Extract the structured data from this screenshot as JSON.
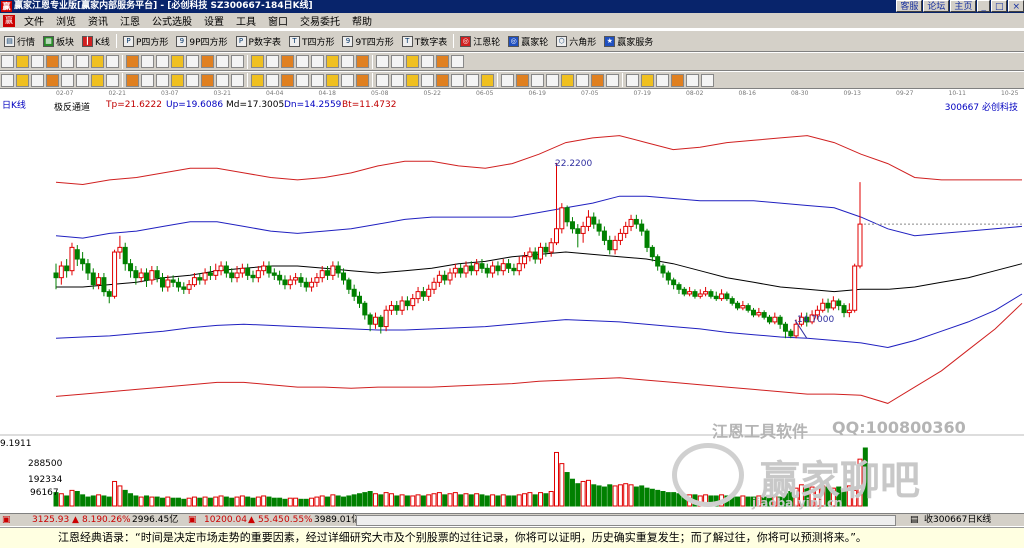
{
  "window": {
    "title": "赢家江恩专业版[赢家内部服务平台] - [必创科技  SZ300667-184日K线]",
    "buttons": [
      "客服",
      "论坛",
      "主页"
    ]
  },
  "menu": [
    "文件",
    "浏览",
    "资讯",
    "江恩",
    "公式选股",
    "设置",
    "工具",
    "窗口",
    "交易委托",
    "帮助"
  ],
  "toolbar1": [
    "行情",
    "板块",
    "K线",
    "P四方形",
    "9P四方形",
    "P数字表",
    "T四方形",
    "9T四方形",
    "T数字表",
    "江恩轮",
    "赢家轮",
    "六角形",
    "赢家服务"
  ],
  "toolbar2_icon_count": 30,
  "toolbar3_icon_count": 46,
  "date_ticks": [
    "02-07",
    "02-21",
    "03-07",
    "03-21",
    "04-04",
    "04-18",
    "05-08",
    "05-22",
    "06-05",
    "06-19",
    "07-05",
    "07-19",
    "08-02",
    "08-16",
    "08-30",
    "09-13",
    "09-27",
    "10-11",
    "10-25"
  ],
  "chart_header": {
    "period": "日K线",
    "indicator": "极反通道",
    "tp": "Tp=21.6222",
    "up": "Up=19.6086",
    "md": "Md=17.3005",
    "dn": "Dn=14.2559",
    "bt": "Bt=11.4732",
    "stock": "300667  必创科技"
  },
  "chart_annotations": {
    "high": "22.2200",
    "low": "14.7000"
  },
  "volume_axis": [
    "9.1911",
    "288500",
    "192334",
    "96167"
  ],
  "watermark": {
    "brand": "江恩工具软件",
    "qq": "QQ:100800360",
    "cn": "赢家聊吧",
    "url": "jiaoba.yinj.cn"
  },
  "status_bar": {
    "sh": "3125.93",
    "sh_chg": "8.19",
    "sh_pct": "0.26%",
    "sh_amt": "2996.45亿",
    "sz": "10200.04",
    "sz_chg": "55.45",
    "sz_pct": "0.55%",
    "sz_amt": "3989.01亿",
    "right": "收300667日K线"
  },
  "quote": "江恩经典语录：“时间是决定市场走势的重要因素，经过详细研究大市及个别股票的过往记录，你将可以证明，历史确实重复发生；而了解过往，你将可以预测将来。”。",
  "chart_data": {
    "type": "candlestick",
    "title": "极反通道",
    "ylim": [
      10.5,
      24.5
    ],
    "annotations": {
      "high": 22.22,
      "low": 14.7
    },
    "bands": {
      "tp": [
        21.4,
        21.3,
        21.5,
        21.6,
        21.8,
        22.0,
        22.0,
        21.8,
        21.6,
        21.5,
        21.6,
        21.8,
        22.1,
        22.3,
        22.3,
        22.1,
        22.0,
        22.2,
        22.6,
        23.1,
        23.3,
        23.4,
        23.1,
        22.8,
        22.9,
        23.1,
        23.2,
        23.3,
        23.4,
        23.1,
        22.6,
        22.2,
        21.6,
        21.5,
        21.5,
        21.5,
        21.5
      ],
      "up": [
        19.1,
        19.0,
        19.2,
        19.3,
        19.5,
        19.7,
        19.7,
        19.5,
        19.3,
        19.2,
        19.3,
        19.4,
        19.6,
        19.8,
        19.9,
        19.9,
        19.9,
        19.9,
        20.1,
        20.3,
        20.5,
        20.8,
        20.8,
        20.7,
        20.6,
        20.6,
        20.6,
        20.5,
        20.4,
        20.3,
        19.9,
        19.4,
        19.1,
        19.2,
        19.3,
        19.4,
        19.5
      ],
      "md": [
        16.9,
        16.9,
        17.0,
        17.1,
        17.3,
        17.4,
        17.6,
        17.7,
        17.8,
        17.8,
        17.7,
        17.6,
        17.5,
        17.6,
        17.7,
        17.9,
        18.0,
        18.2,
        18.3,
        18.4,
        18.3,
        18.2,
        18.1,
        17.9,
        17.6,
        17.3,
        17.1,
        16.9,
        16.8,
        16.7,
        16.8,
        16.8,
        16.9,
        17.1,
        17.3,
        17.6,
        17.9
      ],
      "dn": [
        14.7,
        14.75,
        14.8,
        14.9,
        15.0,
        15.15,
        15.25,
        15.3,
        15.25,
        15.2,
        15.15,
        15.1,
        15.05,
        15.05,
        15.1,
        15.15,
        15.2,
        15.3,
        15.4,
        15.5,
        15.45,
        15.4,
        15.3,
        15.2,
        15.1,
        14.95,
        14.85,
        14.75,
        14.7,
        14.6,
        14.5,
        14.3,
        14.6,
        15.0,
        15.4,
        15.9,
        16.6
      ],
      "bt": [
        12.2,
        12.3,
        12.4,
        12.5,
        12.6,
        12.7,
        12.8,
        12.8,
        12.7,
        12.6,
        12.6,
        12.55,
        12.6,
        12.6,
        12.6,
        12.65,
        12.7,
        12.75,
        12.85,
        12.9,
        12.95,
        13.0,
        12.9,
        12.8,
        12.7,
        12.6,
        12.5,
        12.4,
        12.3,
        12.3,
        12.25,
        11.9,
        12.6,
        13.3,
        14.2,
        15.1,
        16.2
      ]
    },
    "candles": [
      [
        17.5,
        17.3,
        17.9,
        16.8
      ],
      [
        17.3,
        17.8,
        18.0,
        17.0
      ],
      [
        17.8,
        17.6,
        18.1,
        17.3
      ],
      [
        17.6,
        18.6,
        18.8,
        17.4
      ],
      [
        18.5,
        18.1,
        18.7,
        17.8
      ],
      [
        18.1,
        17.9,
        18.4,
        17.6
      ],
      [
        17.9,
        17.5,
        18.1,
        17.2
      ],
      [
        17.5,
        17.0,
        17.7,
        16.8
      ],
      [
        17.0,
        17.3,
        17.5,
        16.8
      ],
      [
        17.3,
        16.7,
        17.5,
        16.5
      ],
      [
        16.7,
        16.5,
        16.8,
        16.2
      ],
      [
        16.5,
        18.4,
        18.5,
        16.4
      ],
      [
        18.4,
        18.6,
        19.1,
        18.1
      ],
      [
        18.6,
        17.9,
        18.8,
        17.6
      ],
      [
        17.9,
        17.6,
        18.1,
        17.3
      ],
      [
        17.6,
        17.3,
        17.8,
        17.0
      ],
      [
        17.3,
        17.5,
        17.7,
        17.1
      ],
      [
        17.5,
        17.2,
        17.7,
        16.9
      ],
      [
        17.2,
        17.6,
        17.8,
        17.0
      ],
      [
        17.6,
        17.3,
        17.8,
        17.1
      ],
      [
        17.3,
        16.9,
        17.5,
        16.7
      ],
      [
        16.9,
        17.2,
        17.4,
        16.7
      ],
      [
        17.2,
        17.1,
        17.4,
        16.9
      ],
      [
        17.1,
        16.9,
        17.3,
        16.7
      ],
      [
        16.9,
        16.8,
        17.1,
        16.6
      ],
      [
        16.8,
        17.0,
        17.2,
        16.6
      ],
      [
        17.0,
        17.3,
        17.5,
        16.9
      ],
      [
        17.3,
        17.2,
        17.5,
        17.0
      ],
      [
        17.2,
        17.5,
        17.7,
        17.0
      ],
      [
        17.5,
        17.4,
        17.8,
        17.2
      ],
      [
        17.4,
        17.6,
        17.9,
        17.2
      ],
      [
        17.6,
        17.8,
        18.0,
        17.4
      ],
      [
        17.8,
        17.5,
        18.0,
        17.3
      ],
      [
        17.5,
        17.3,
        17.7,
        17.1
      ],
      [
        17.3,
        17.5,
        17.8,
        17.1
      ],
      [
        17.5,
        17.7,
        17.9,
        17.3
      ],
      [
        17.7,
        17.4,
        17.9,
        17.2
      ],
      [
        17.4,
        17.3,
        17.6,
        17.1
      ],
      [
        17.3,
        17.6,
        17.8,
        17.1
      ],
      [
        17.6,
        17.8,
        18.0,
        17.4
      ],
      [
        17.8,
        17.5,
        18.0,
        17.3
      ],
      [
        17.5,
        17.4,
        17.7,
        17.2
      ],
      [
        17.4,
        17.2,
        17.6,
        17.0
      ],
      [
        17.2,
        17.0,
        17.4,
        16.8
      ],
      [
        17.0,
        17.2,
        17.4,
        16.8
      ],
      [
        17.2,
        17.3,
        17.5,
        17.0
      ],
      [
        17.3,
        17.1,
        17.5,
        16.9
      ],
      [
        17.1,
        16.9,
        17.3,
        16.7
      ],
      [
        16.9,
        17.1,
        17.3,
        16.7
      ],
      [
        17.1,
        17.3,
        17.5,
        16.9
      ],
      [
        17.3,
        17.6,
        17.8,
        17.1
      ],
      [
        17.6,
        17.4,
        17.8,
        17.2
      ],
      [
        17.4,
        17.8,
        18.0,
        17.2
      ],
      [
        17.8,
        17.5,
        18.0,
        17.3
      ],
      [
        17.5,
        17.2,
        17.7,
        17.0
      ],
      [
        17.2,
        16.8,
        17.3,
        16.6
      ],
      [
        16.8,
        16.5,
        17.0,
        16.3
      ],
      [
        16.5,
        16.2,
        16.7,
        16.0
      ],
      [
        16.2,
        15.7,
        16.3,
        15.5
      ],
      [
        15.7,
        15.3,
        15.8,
        15.0
      ],
      [
        15.3,
        15.6,
        15.8,
        15.1
      ],
      [
        15.6,
        15.2,
        15.7,
        14.9
      ],
      [
        15.2,
        15.9,
        16.1,
        15.0
      ],
      [
        15.9,
        16.1,
        16.3,
        15.7
      ],
      [
        16.1,
        15.9,
        16.3,
        15.7
      ],
      [
        15.9,
        16.3,
        16.5,
        15.7
      ],
      [
        16.3,
        16.1,
        16.5,
        15.9
      ],
      [
        16.1,
        16.4,
        16.6,
        15.9
      ],
      [
        16.4,
        16.7,
        16.9,
        16.2
      ],
      [
        16.7,
        16.5,
        16.9,
        16.3
      ],
      [
        16.5,
        16.8,
        17.0,
        16.3
      ],
      [
        16.8,
        17.1,
        17.3,
        16.6
      ],
      [
        17.1,
        17.4,
        17.6,
        16.9
      ],
      [
        17.4,
        17.2,
        17.6,
        17.0
      ],
      [
        17.2,
        17.5,
        17.7,
        17.0
      ],
      [
        17.5,
        17.7,
        17.9,
        17.3
      ],
      [
        17.7,
        17.5,
        17.9,
        17.3
      ],
      [
        17.5,
        17.8,
        18.0,
        17.3
      ],
      [
        17.8,
        17.6,
        18.0,
        17.4
      ],
      [
        17.6,
        17.9,
        18.1,
        17.4
      ],
      [
        17.9,
        17.7,
        18.1,
        17.5
      ],
      [
        17.7,
        17.5,
        17.9,
        17.3
      ],
      [
        17.5,
        17.8,
        18.0,
        17.3
      ],
      [
        17.8,
        17.6,
        18.0,
        17.4
      ],
      [
        17.6,
        17.9,
        18.1,
        17.4
      ],
      [
        17.9,
        17.7,
        18.1,
        17.5
      ],
      [
        17.7,
        17.6,
        17.9,
        17.4
      ],
      [
        17.6,
        17.9,
        18.2,
        17.4
      ],
      [
        17.9,
        18.2,
        18.4,
        17.7
      ],
      [
        18.2,
        18.4,
        18.6,
        18.0
      ],
      [
        18.4,
        18.1,
        18.6,
        17.9
      ],
      [
        18.1,
        18.6,
        18.8,
        17.9
      ],
      [
        18.6,
        18.4,
        18.8,
        18.2
      ],
      [
        18.4,
        18.8,
        19.0,
        18.2
      ],
      [
        18.8,
        19.4,
        22.22,
        18.7
      ],
      [
        19.4,
        20.3,
        20.5,
        19.2
      ],
      [
        20.3,
        19.7,
        20.4,
        19.5
      ],
      [
        19.7,
        19.4,
        19.9,
        19.2
      ],
      [
        19.4,
        19.2,
        19.6,
        18.6
      ],
      [
        19.2,
        19.5,
        19.7,
        18.8
      ],
      [
        19.5,
        19.9,
        20.2,
        19.3
      ],
      [
        19.9,
        19.6,
        20.1,
        19.4
      ],
      [
        19.6,
        19.3,
        19.8,
        19.1
      ],
      [
        19.3,
        18.9,
        19.5,
        18.7
      ],
      [
        18.9,
        18.5,
        19.1,
        18.3
      ],
      [
        18.5,
        18.9,
        19.1,
        18.3
      ],
      [
        18.9,
        19.2,
        19.4,
        18.7
      ],
      [
        19.2,
        19.5,
        19.7,
        19.0
      ],
      [
        19.5,
        19.8,
        20.0,
        19.3
      ],
      [
        19.8,
        19.6,
        20.0,
        19.4
      ],
      [
        19.6,
        19.3,
        19.8,
        19.1
      ],
      [
        19.3,
        18.6,
        19.4,
        18.4
      ],
      [
        18.6,
        18.2,
        18.7,
        18.0
      ],
      [
        18.2,
        17.8,
        18.3,
        17.6
      ],
      [
        17.8,
        17.5,
        17.9,
        17.3
      ],
      [
        17.5,
        17.2,
        17.6,
        17.0
      ],
      [
        17.2,
        17.0,
        17.3,
        16.8
      ],
      [
        17.0,
        16.8,
        17.1,
        16.6
      ],
      [
        16.8,
        16.6,
        16.9,
        16.5
      ],
      [
        16.6,
        16.7,
        16.9,
        16.5
      ],
      [
        16.7,
        16.5,
        16.8,
        16.4
      ],
      [
        16.5,
        16.6,
        16.8,
        16.4
      ],
      [
        16.6,
        16.7,
        16.9,
        16.5
      ],
      [
        16.7,
        16.5,
        16.8,
        16.4
      ],
      [
        16.5,
        16.4,
        16.7,
        16.3
      ],
      [
        16.4,
        16.6,
        16.8,
        16.3
      ],
      [
        16.6,
        16.4,
        16.7,
        16.3
      ],
      [
        16.4,
        16.2,
        16.5,
        16.1
      ],
      [
        16.2,
        16.0,
        16.3,
        15.9
      ],
      [
        16.0,
        16.1,
        16.3,
        15.9
      ],
      [
        16.1,
        15.9,
        16.2,
        15.8
      ],
      [
        15.9,
        15.7,
        16.0,
        15.6
      ],
      [
        15.7,
        15.8,
        16.0,
        15.6
      ],
      [
        15.8,
        15.6,
        15.9,
        15.5
      ],
      [
        15.6,
        15.4,
        15.7,
        15.3
      ],
      [
        15.4,
        15.6,
        15.8,
        15.3
      ],
      [
        15.6,
        15.3,
        15.7,
        15.1
      ],
      [
        15.3,
        15.0,
        15.4,
        14.7
      ],
      [
        15.0,
        14.8,
        15.1,
        14.7
      ],
      [
        14.8,
        15.3,
        15.5,
        14.7
      ],
      [
        15.3,
        15.6,
        15.8,
        15.2
      ],
      [
        15.6,
        15.4,
        15.8,
        15.2
      ],
      [
        15.4,
        15.7,
        15.9,
        15.3
      ],
      [
        15.7,
        15.9,
        16.1,
        15.5
      ],
      [
        15.9,
        16.2,
        16.4,
        15.8
      ],
      [
        16.2,
        16.0,
        16.4,
        15.8
      ],
      [
        16.0,
        16.3,
        16.5,
        15.9
      ],
      [
        16.3,
        16.1,
        16.4,
        15.9
      ],
      [
        16.1,
        15.8,
        16.2,
        15.6
      ],
      [
        15.8,
        15.9,
        16.2,
        15.6
      ],
      [
        15.9,
        17.8,
        17.9,
        15.8
      ],
      [
        17.8,
        19.6,
        21.4,
        17.7
      ]
    ],
    "volume_max": 288500,
    "volumes": [
      60,
      55,
      45,
      70,
      65,
      50,
      40,
      45,
      50,
      45,
      40,
      110,
      90,
      70,
      55,
      45,
      40,
      45,
      40,
      40,
      35,
      40,
      35,
      35,
      30,
      35,
      40,
      35,
      40,
      35,
      40,
      45,
      40,
      35,
      40,
      45,
      40,
      35,
      40,
      45,
      40,
      35,
      35,
      30,
      35,
      35,
      30,
      30,
      35,
      40,
      45,
      40,
      50,
      45,
      40,
      45,
      50,
      55,
      60,
      65,
      55,
      50,
      60,
      55,
      45,
      50,
      45,
      45,
      50,
      45,
      50,
      55,
      60,
      50,
      55,
      60,
      50,
      55,
      50,
      55,
      50,
      45,
      50,
      45,
      50,
      45,
      45,
      50,
      55,
      60,
      50,
      60,
      55,
      65,
      240,
      190,
      150,
      120,
      100,
      110,
      115,
      95,
      90,
      85,
      95,
      90,
      95,
      100,
      95,
      85,
      90,
      80,
      75,
      70,
      65,
      60,
      60,
      55,
      50,
      50,
      50,
      45,
      50,
      45,
      45,
      50,
      45,
      45,
      40,
      45,
      40,
      40,
      45,
      40,
      45,
      45,
      40,
      55,
      65,
      80,
      95,
      80,
      85,
      80,
      90,
      85,
      80,
      85,
      75,
      90,
      70,
      210,
      260
    ]
  }
}
